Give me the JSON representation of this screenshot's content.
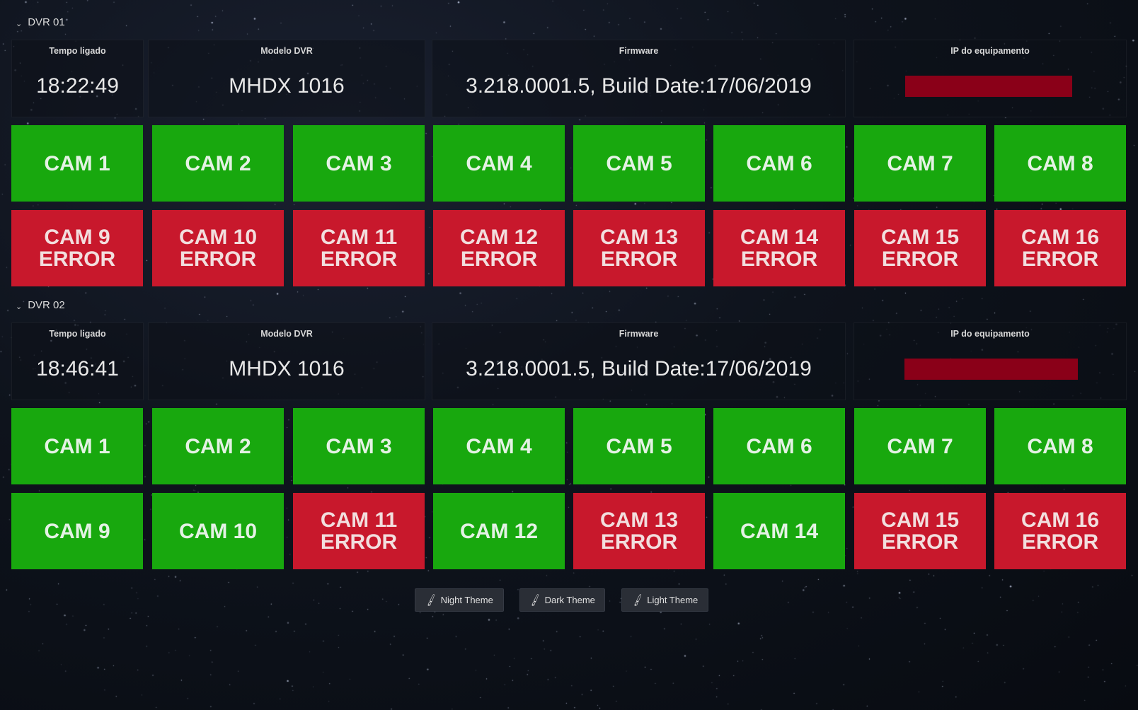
{
  "dvrs": [
    {
      "name": "DVR 01",
      "stats": {
        "uptime_title": "Tempo ligado",
        "uptime": "18:22:49",
        "model_title": "Modelo DVR",
        "model": "MHDX 1016",
        "firmware_title": "Firmware",
        "firmware": "3.218.0001.5, Build Date:17/06/2019",
        "ip_title": "IP do equipamento"
      },
      "cams": [
        {
          "label": "CAM 1",
          "status": "ok"
        },
        {
          "label": "CAM 2",
          "status": "ok"
        },
        {
          "label": "CAM 3",
          "status": "ok"
        },
        {
          "label": "CAM 4",
          "status": "ok"
        },
        {
          "label": "CAM 5",
          "status": "ok"
        },
        {
          "label": "CAM 6",
          "status": "ok"
        },
        {
          "label": "CAM 7",
          "status": "ok"
        },
        {
          "label": "CAM 8",
          "status": "ok"
        },
        {
          "label": "CAM 9\nERROR",
          "status": "error"
        },
        {
          "label": "CAM 10\nERROR",
          "status": "error"
        },
        {
          "label": "CAM 11\nERROR",
          "status": "error"
        },
        {
          "label": "CAM 12\nERROR",
          "status": "error"
        },
        {
          "label": "CAM 13\nERROR",
          "status": "error"
        },
        {
          "label": "CAM 14\nERROR",
          "status": "error"
        },
        {
          "label": "CAM 15\nERROR",
          "status": "error"
        },
        {
          "label": "CAM 16\nERROR",
          "status": "error"
        }
      ]
    },
    {
      "name": "DVR 02",
      "stats": {
        "uptime_title": "Tempo ligado",
        "uptime": "18:46:41",
        "model_title": "Modelo DVR",
        "model": "MHDX 1016",
        "firmware_title": "Firmware",
        "firmware": "3.218.0001.5, Build Date:17/06/2019",
        "ip_title": "IP do equipamento"
      },
      "cams": [
        {
          "label": "CAM 1",
          "status": "ok"
        },
        {
          "label": "CAM 2",
          "status": "ok"
        },
        {
          "label": "CAM 3",
          "status": "ok"
        },
        {
          "label": "CAM 4",
          "status": "ok"
        },
        {
          "label": "CAM 5",
          "status": "ok"
        },
        {
          "label": "CAM 6",
          "status": "ok"
        },
        {
          "label": "CAM 7",
          "status": "ok"
        },
        {
          "label": "CAM 8",
          "status": "ok"
        },
        {
          "label": "CAM 9",
          "status": "ok"
        },
        {
          "label": "CAM 10",
          "status": "ok"
        },
        {
          "label": "CAM 11\nERROR",
          "status": "error"
        },
        {
          "label": "CAM 12",
          "status": "ok"
        },
        {
          "label": "CAM 13\nERROR",
          "status": "error"
        },
        {
          "label": "CAM 14",
          "status": "ok"
        },
        {
          "label": "CAM 15\nERROR",
          "status": "error"
        },
        {
          "label": "CAM 16\nERROR",
          "status": "error"
        }
      ]
    }
  ],
  "themes": {
    "night": "Night Theme",
    "dark": "Dark Theme",
    "light": "Light Theme",
    "icon": "brush-icon"
  },
  "colors": {
    "ok": "#18a80e",
    "error": "#c8182c",
    "ip_redacted": "#8a0018"
  }
}
